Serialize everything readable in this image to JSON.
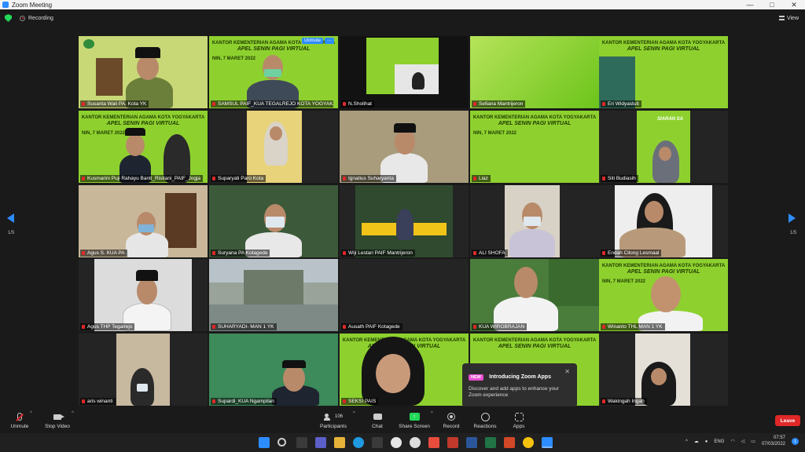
{
  "window": {
    "title": "Zoom Meeting",
    "controls": [
      "—",
      "□",
      "✕"
    ]
  },
  "meeting_bar": {
    "recording_label": "Recording",
    "view_label": "View"
  },
  "gallery": {
    "page_left": "1/5",
    "page_right": "1/5",
    "unmute_chip": "Unmute",
    "more_chip": "···",
    "banner_line1": "KANTOR KEMENTERIAN AGAMA KOTA YOGYAKARTA",
    "banner_line2": "APEL SENIN PAGI VIRTUAL",
    "banner_date": "NIN, 7 MARET 2022",
    "siaran_text": "SIARAN SA",
    "participants": [
      "Susanta Wali PA. Kota YK",
      "SAMSUL PAIF_KUA TEGALREJO KOTA YOGYAKA...",
      "N.Sholihat",
      "Sefiana Mantrijeron",
      "Eri Widyastuti",
      "Kusmarini Puji Rahayu Banti_Ristiani_PAIF_Jogja",
      "Suparyati Paro Kota",
      "Ignatius Suharyanta",
      "Liaz",
      "Siti Budiasih",
      "Agus S. KUA PA",
      "Suryana PA Kotagede",
      "Wiji Lestari PAIF Mantrijeron",
      "ALI SHOFA",
      "Endah Cilong Lesmaal",
      "Agus THP Tegalrejo",
      "SUHARYADI- MAN 1 YK",
      "Ausath PAIF Kotagede",
      "KUA WIROBRAJAN",
      "Winanto THL MAN 1 YK",
      "aris winanti",
      "Supardi_KUA Ngampilan",
      "SEKSI PAIS",
      "Wakingah Ingah"
    ]
  },
  "toast": {
    "badge": "NEW",
    "title": "Introducing Zoom Apps",
    "body": "Discover and add apps to enhance your Zoom experience",
    "close": "✕"
  },
  "toolbar": {
    "unmute": "Unmute",
    "stop_video": "Stop Video",
    "participants": "Participants",
    "participant_count": "106",
    "chat": "Chat",
    "share_screen": "Share Screen",
    "record": "Record",
    "reactions": "Reactions",
    "apps": "Apps",
    "leave": "Leave"
  },
  "taskbar": {
    "language": "ENG",
    "time": "07:57",
    "date": "07/03/2022",
    "notif_count": "1"
  },
  "colors": {
    "zoom_blue": "#2d8cff",
    "leave_red": "#e02828",
    "share_green": "#23d959",
    "banner_green": "#7ed321"
  }
}
